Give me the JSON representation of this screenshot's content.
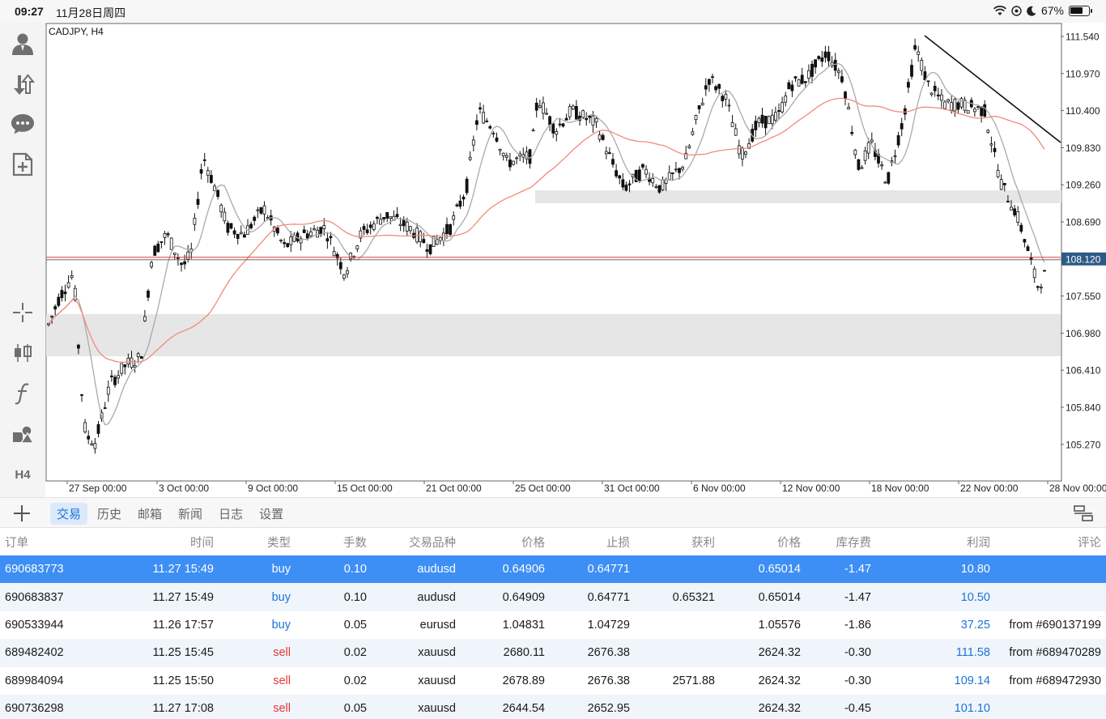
{
  "status_bar": {
    "time": "09:27",
    "date": "11月28日周四",
    "battery": "67%",
    "battery_level": 0.67
  },
  "chart": {
    "symbol": "CADJPY, H4",
    "current_price": "108.120",
    "price_ticks": [
      "111.540",
      "110.970",
      "110.400",
      "109.830",
      "109.260",
      "108.690",
      "108.120",
      "107.550",
      "106.980",
      "106.410",
      "105.840",
      "105.270"
    ],
    "time_ticks": [
      "27 Sep 00:00",
      "3 Oct 00:00",
      "9 Oct 00:00",
      "15 Oct 00:00",
      "21 Oct 00:00",
      "25 Oct 00:00",
      "31 Oct 00:00",
      "6 Nov 00:00",
      "12 Nov 00:00",
      "18 Nov 00:00",
      "22 Nov 00:00",
      "28 Nov 00:00"
    ],
    "colors": {
      "price_line": "#e53935",
      "price_badge": "#2f5a86",
      "ma_fast": "#aaaaaa",
      "ma_slow": "#f08a7a",
      "zones": "#e6e6e6"
    }
  },
  "left_tools": {
    "icons": [
      "account-icon",
      "trade-icon",
      "chat-icon",
      "new-order-icon",
      "crosshair-icon",
      "chart-type-icon",
      "indicator-icon",
      "objects-icon"
    ],
    "timeframe": "H4"
  },
  "tabs": [
    "交易",
    "历史",
    "邮箱",
    "新闻",
    "日志",
    "设置"
  ],
  "active_tab": "交易",
  "table": {
    "headers": [
      "订单",
      "时间",
      "类型",
      "手数",
      "交易品种",
      "价格",
      "止损",
      "获利",
      "价格",
      "库存费",
      "利润",
      "评论"
    ],
    "rows": [
      {
        "order": "690683773",
        "time": "11.27 15:49",
        "type": "buy",
        "lots": "0.10",
        "symbol": "audusd",
        "price": "0.64906",
        "sl": "0.64771",
        "tp": "",
        "cur": "0.65014",
        "swap": "-1.47",
        "profit": "10.80",
        "comment": ""
      },
      {
        "order": "690683837",
        "time": "11.27 15:49",
        "type": "buy",
        "lots": "0.10",
        "symbol": "audusd",
        "price": "0.64909",
        "sl": "0.64771",
        "tp": "0.65321",
        "cur": "0.65014",
        "swap": "-1.47",
        "profit": "10.50",
        "comment": ""
      },
      {
        "order": "690533944",
        "time": "11.26 17:57",
        "type": "buy",
        "lots": "0.05",
        "symbol": "eurusd",
        "price": "1.04831",
        "sl": "1.04729",
        "tp": "",
        "cur": "1.05576",
        "swap": "-1.86",
        "profit": "37.25",
        "comment": "from #690137199"
      },
      {
        "order": "689482402",
        "time": "11.25 15:45",
        "type": "sell",
        "lots": "0.02",
        "symbol": "xauusd",
        "price": "2680.11",
        "sl": "2676.38",
        "tp": "",
        "cur": "2624.32",
        "swap": "-0.30",
        "profit": "111.58",
        "comment": "from #689470289"
      },
      {
        "order": "689984094",
        "time": "11.25 15:50",
        "type": "sell",
        "lots": "0.02",
        "symbol": "xauusd",
        "price": "2678.89",
        "sl": "2676.38",
        "tp": "2571.88",
        "cur": "2624.32",
        "swap": "-0.30",
        "profit": "109.14",
        "comment": "from #689472930"
      },
      {
        "order": "690736298",
        "time": "11.27 17:08",
        "type": "sell",
        "lots": "0.05",
        "symbol": "xauusd",
        "price": "2644.54",
        "sl": "2652.95",
        "tp": "",
        "cur": "2624.32",
        "swap": "-0.45",
        "profit": "101.10",
        "comment": ""
      }
    ]
  }
}
